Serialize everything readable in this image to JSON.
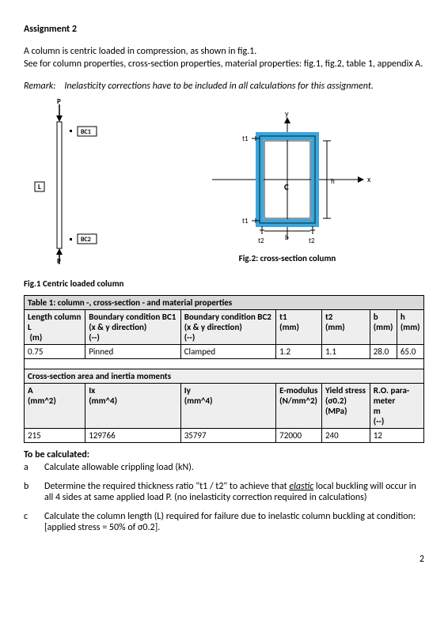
{
  "title": "Assignment 2",
  "intro": {
    "line1": "A column is centric loaded in compression, as shown in fig.1.",
    "line2": "See for column properties, cross-section properties, material properties: fig.1, fig.2, table 1, appendix A."
  },
  "remark": {
    "label": "Remark:",
    "text": "Inelasticity corrections have to be included in all calculations for this assignment."
  },
  "fig1": {
    "labels": {
      "P_top": "P",
      "P_bot": "P",
      "BC1": "BC1",
      "BC2": "BC2",
      "L": "L"
    },
    "caption": "Fig.1 Centric loaded column"
  },
  "fig2": {
    "labels": {
      "y": "y",
      "x": "x",
      "t1a": "t1",
      "t1b": "t1",
      "t2a": "t2",
      "t2b": "t2",
      "b": "b",
      "h": "h",
      "c": "C"
    },
    "caption": "Fig.2: cross-section column"
  },
  "table1": {
    "caption": "Table 1: column -, cross-section - and material properties",
    "headers1": {
      "c1": "Length column L",
      "c1b": "(m)",
      "c2": "Boundary condition BC1",
      "c2b": "(x & y direction)",
      "c2c": "(--)",
      "c3": "Boundary condition BC2",
      "c3b": "(x & y direction)",
      "c3c": "(--)",
      "c4": "t1",
      "c4b": "(mm)",
      "c5": "t2",
      "c5b": "(mm)",
      "c6": "b",
      "c6b": "(mm)",
      "c7": "h",
      "c7b": "(mm)"
    },
    "row1": {
      "c1": "0.75",
      "c2": "Pinned",
      "c3": "Clamped",
      "c4": "1.2",
      "c5": "1.1",
      "c6": "28.0",
      "c7": "65.0"
    },
    "subcaption": "Cross-section area and inertia moments",
    "headers2": {
      "c1": "A",
      "c1b": "(mm^2)",
      "c2": "Ix",
      "c2b": "(mm^4)",
      "c3": "Iy",
      "c3b": "(mm^4)",
      "c4": "E-modulus",
      "c4b": "(N/mm^2)",
      "c5": "Yield stress (σ0.2)",
      "c5b": "(MPa)",
      "c6": "R.O. para-meter",
      "c6b": "m",
      "c6c": "(--)"
    },
    "row2": {
      "c1": "215",
      "c2": "129766",
      "c3": "35797",
      "c4": "72000",
      "c5": "240",
      "c6": "12"
    }
  },
  "calc": {
    "heading": "To be calculated:",
    "a_label": "a",
    "a_text": "Calculate allowable crippling load (kN).",
    "b_label": "b",
    "b_text1": "Determine the required thickness ratio \"t1 / t2\" to achieve that ",
    "b_text_elastic": "elastic",
    "b_text2": " local buckling will occur in all 4 sides at same applied load P. (no inelasticity correction required in calculations)",
    "c_label": "c",
    "c_text": "Calculate the column length (L) required for failure due to inelastic column buckling at condition: [applied stress =  50% of σ0.2]."
  },
  "pagenumber": "2"
}
